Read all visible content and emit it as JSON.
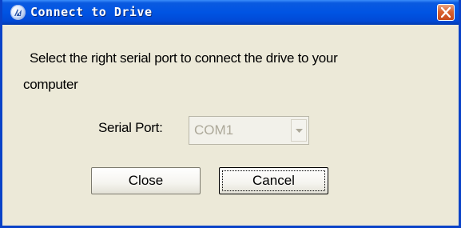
{
  "window": {
    "title": "Connect to Drive",
    "icon": "app-logo-icon",
    "close_icon": "close-icon",
    "titlebar_color": "#0054e3",
    "close_color": "#d9612e"
  },
  "message": {
    "line1": "Select the right serial port to connect the drive to your",
    "line2": "computer"
  },
  "serial_port": {
    "label": "Serial Port:",
    "selected": "COM1",
    "enabled": false
  },
  "buttons": {
    "close_label": "Close",
    "cancel_label": "Cancel"
  }
}
